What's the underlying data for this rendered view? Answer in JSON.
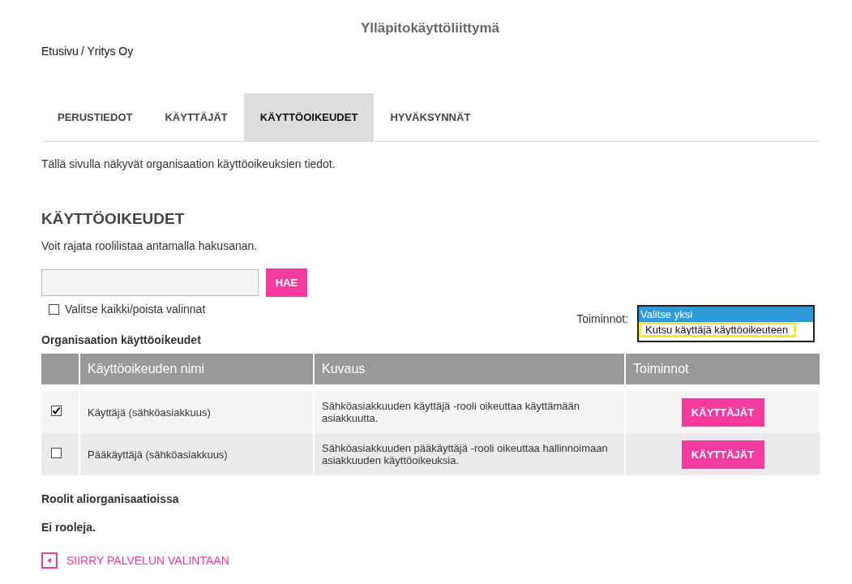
{
  "header": {
    "title": "Ylläpitokäyttöliittymä"
  },
  "breadcrumb": [
    {
      "label": "Etusivu"
    },
    {
      "label": "/ Yritys Oy"
    }
  ],
  "tabs": [
    {
      "label": "PERUSTIEDOT",
      "selected": false
    },
    {
      "label": "KÄYTTÄJÄT",
      "selected": false
    },
    {
      "label": "KÄYTTÖOIKEUDET",
      "selected": true
    },
    {
      "label": "HYVÄKSYNNÄT",
      "selected": false
    }
  ],
  "intro": "Tällä sivulla näkyvät organisaation käyttöoikeuksien tiedot.",
  "heading": "KÄYTTÖOIKEUDET",
  "hint": "Voit rajata roolilistaa antamalla hakusanan.",
  "search": {
    "button": "HAE"
  },
  "select_all": {
    "label": "Valitse kaikki/poista valinnat",
    "checked": false
  },
  "actions": {
    "label": "Toiminnot:",
    "expanded": true,
    "options": [
      {
        "label": "Valitse yksi",
        "selected": true,
        "outlined": false
      },
      {
        "label": "Kutsu käyttäjä käyttöoikeuteen",
        "selected": false,
        "outlined": true
      }
    ]
  },
  "table": {
    "caption": "Organisaation käyttöoikeudet",
    "columns": [
      "Käyttöoikeuden nimi",
      "Kuvaus",
      "Toiminnot"
    ],
    "rows": [
      {
        "checked": true,
        "name": "Käyttäjä (sähköasiakkuus)",
        "description": "Sähköasiakkuuden käyttäjä -rooli oikeuttaa käyttämään asiakkuutta.",
        "button": "KÄYTTÄJÄT"
      },
      {
        "checked": false,
        "name": "Pääkäyttäjä (sähköasiakkuus)",
        "description": "Sähköasiakkuuden pääkäyttäjä -rooli oikeuttaa hallinnoimaan asiakkuuden käyttöoikeuksia.",
        "button": "KÄYTTÄJÄT"
      }
    ]
  },
  "sub_heading": "Roolit aliorganisaatioissa",
  "empty": "Ei rooleja.",
  "back_link": "SIIRRY PALVELUN VALINTAAN"
}
